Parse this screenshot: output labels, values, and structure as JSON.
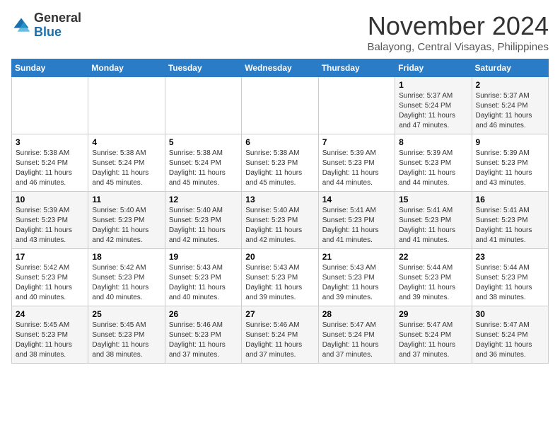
{
  "header": {
    "logo_general": "General",
    "logo_blue": "Blue",
    "month": "November 2024",
    "location": "Balayong, Central Visayas, Philippines"
  },
  "weekdays": [
    "Sunday",
    "Monday",
    "Tuesday",
    "Wednesday",
    "Thursday",
    "Friday",
    "Saturday"
  ],
  "weeks": [
    [
      {
        "day": "",
        "info": ""
      },
      {
        "day": "",
        "info": ""
      },
      {
        "day": "",
        "info": ""
      },
      {
        "day": "",
        "info": ""
      },
      {
        "day": "",
        "info": ""
      },
      {
        "day": "1",
        "info": "Sunrise: 5:37 AM\nSunset: 5:24 PM\nDaylight: 11 hours and 47 minutes."
      },
      {
        "day": "2",
        "info": "Sunrise: 5:37 AM\nSunset: 5:24 PM\nDaylight: 11 hours and 46 minutes."
      }
    ],
    [
      {
        "day": "3",
        "info": "Sunrise: 5:38 AM\nSunset: 5:24 PM\nDaylight: 11 hours and 46 minutes."
      },
      {
        "day": "4",
        "info": "Sunrise: 5:38 AM\nSunset: 5:24 PM\nDaylight: 11 hours and 45 minutes."
      },
      {
        "day": "5",
        "info": "Sunrise: 5:38 AM\nSunset: 5:24 PM\nDaylight: 11 hours and 45 minutes."
      },
      {
        "day": "6",
        "info": "Sunrise: 5:38 AM\nSunset: 5:23 PM\nDaylight: 11 hours and 45 minutes."
      },
      {
        "day": "7",
        "info": "Sunrise: 5:39 AM\nSunset: 5:23 PM\nDaylight: 11 hours and 44 minutes."
      },
      {
        "day": "8",
        "info": "Sunrise: 5:39 AM\nSunset: 5:23 PM\nDaylight: 11 hours and 44 minutes."
      },
      {
        "day": "9",
        "info": "Sunrise: 5:39 AM\nSunset: 5:23 PM\nDaylight: 11 hours and 43 minutes."
      }
    ],
    [
      {
        "day": "10",
        "info": "Sunrise: 5:39 AM\nSunset: 5:23 PM\nDaylight: 11 hours and 43 minutes."
      },
      {
        "day": "11",
        "info": "Sunrise: 5:40 AM\nSunset: 5:23 PM\nDaylight: 11 hours and 42 minutes."
      },
      {
        "day": "12",
        "info": "Sunrise: 5:40 AM\nSunset: 5:23 PM\nDaylight: 11 hours and 42 minutes."
      },
      {
        "day": "13",
        "info": "Sunrise: 5:40 AM\nSunset: 5:23 PM\nDaylight: 11 hours and 42 minutes."
      },
      {
        "day": "14",
        "info": "Sunrise: 5:41 AM\nSunset: 5:23 PM\nDaylight: 11 hours and 41 minutes."
      },
      {
        "day": "15",
        "info": "Sunrise: 5:41 AM\nSunset: 5:23 PM\nDaylight: 11 hours and 41 minutes."
      },
      {
        "day": "16",
        "info": "Sunrise: 5:41 AM\nSunset: 5:23 PM\nDaylight: 11 hours and 41 minutes."
      }
    ],
    [
      {
        "day": "17",
        "info": "Sunrise: 5:42 AM\nSunset: 5:23 PM\nDaylight: 11 hours and 40 minutes."
      },
      {
        "day": "18",
        "info": "Sunrise: 5:42 AM\nSunset: 5:23 PM\nDaylight: 11 hours and 40 minutes."
      },
      {
        "day": "19",
        "info": "Sunrise: 5:43 AM\nSunset: 5:23 PM\nDaylight: 11 hours and 40 minutes."
      },
      {
        "day": "20",
        "info": "Sunrise: 5:43 AM\nSunset: 5:23 PM\nDaylight: 11 hours and 39 minutes."
      },
      {
        "day": "21",
        "info": "Sunrise: 5:43 AM\nSunset: 5:23 PM\nDaylight: 11 hours and 39 minutes."
      },
      {
        "day": "22",
        "info": "Sunrise: 5:44 AM\nSunset: 5:23 PM\nDaylight: 11 hours and 39 minutes."
      },
      {
        "day": "23",
        "info": "Sunrise: 5:44 AM\nSunset: 5:23 PM\nDaylight: 11 hours and 38 minutes."
      }
    ],
    [
      {
        "day": "24",
        "info": "Sunrise: 5:45 AM\nSunset: 5:23 PM\nDaylight: 11 hours and 38 minutes."
      },
      {
        "day": "25",
        "info": "Sunrise: 5:45 AM\nSunset: 5:23 PM\nDaylight: 11 hours and 38 minutes."
      },
      {
        "day": "26",
        "info": "Sunrise: 5:46 AM\nSunset: 5:23 PM\nDaylight: 11 hours and 37 minutes."
      },
      {
        "day": "27",
        "info": "Sunrise: 5:46 AM\nSunset: 5:24 PM\nDaylight: 11 hours and 37 minutes."
      },
      {
        "day": "28",
        "info": "Sunrise: 5:47 AM\nSunset: 5:24 PM\nDaylight: 11 hours and 37 minutes."
      },
      {
        "day": "29",
        "info": "Sunrise: 5:47 AM\nSunset: 5:24 PM\nDaylight: 11 hours and 37 minutes."
      },
      {
        "day": "30",
        "info": "Sunrise: 5:47 AM\nSunset: 5:24 PM\nDaylight: 11 hours and 36 minutes."
      }
    ]
  ]
}
